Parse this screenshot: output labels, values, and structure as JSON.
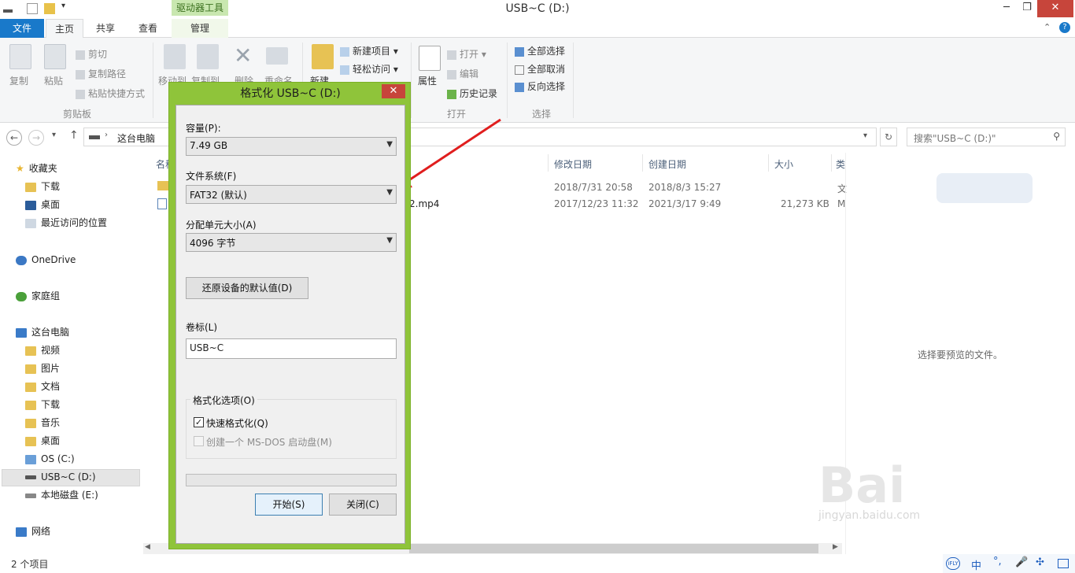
{
  "window": {
    "title": "USB~C (D:)",
    "context_tab_header": "驱动器工具",
    "minimize_glyph": "─",
    "maximize_glyph": "❐",
    "close_glyph": "✕"
  },
  "tabs": [
    {
      "label": "文件"
    },
    {
      "label": "主页"
    },
    {
      "label": "共享"
    },
    {
      "label": "查看"
    },
    {
      "label": "管理"
    }
  ],
  "ribbon": {
    "clipboard": {
      "copy": "复制",
      "paste": "粘贴",
      "cut": "剪切",
      "copy_path": "复制路径",
      "paste_shortcut": "粘贴快捷方式",
      "group": "剪贴板"
    },
    "organize": {
      "move_to": "移动到",
      "copy_to": "复制到",
      "delete": "删除",
      "rename": "重命名"
    },
    "new": {
      "new_folder": "新建",
      "new_item": "新建项目 ▾",
      "easy_access": "轻松访问 ▾"
    },
    "open": {
      "properties": "属性",
      "open": "打开 ▾",
      "edit": "编辑",
      "history": "历史记录",
      "group": "打开"
    },
    "select": {
      "select_all": "全部选择",
      "select_none": "全部取消",
      "invert": "反向选择",
      "group": "选择"
    }
  },
  "address": {
    "path_root": "这台电脑",
    "search_placeholder": "搜索\"USB~C (D:)\""
  },
  "nav": {
    "favorites": "收藏夹",
    "fav_items": [
      "下载",
      "桌面",
      "最近访问的位置"
    ],
    "onedrive": "OneDrive",
    "homegroup": "家庭组",
    "this_pc": "这台电脑",
    "pc_items": [
      "视频",
      "图片",
      "文档",
      "下载",
      "音乐",
      "桌面",
      "OS (C:)",
      "USB~C (D:)",
      "本地磁盘 (E:)"
    ],
    "network": "网络"
  },
  "files": {
    "headers": {
      "name": "名称",
      "modified": "修改日期",
      "created": "创建日期",
      "size": "大小",
      "type": "类"
    },
    "rows": [
      {
        "name": "",
        "modified": "2018/7/31 20:58",
        "created": "2018/8/3 15:27",
        "size": "",
        "type": "文"
      },
      {
        "name": "2.mp4",
        "modified": "2017/12/23 11:32",
        "created": "2021/3/17 9:49",
        "size": "21,273 KB",
        "type": "M"
      }
    ]
  },
  "preview": {
    "empty_text": "选择要预览的文件。"
  },
  "status": {
    "item_count": "2 个项目"
  },
  "dialog": {
    "title": "格式化 USB~C (D:)",
    "close_glyph": "✕",
    "capacity_label": "容量(P):",
    "capacity_value": "7.49 GB",
    "filesystem_label": "文件系统(F)",
    "filesystem_value": "FAT32 (默认)",
    "alloc_label": "分配单元大小(A)",
    "alloc_value": "4096 字节",
    "restore_button": "还原设备的默认值(D)",
    "volume_label": "卷标(L)",
    "volume_value": "USB~C",
    "options_label": "格式化选项(O)",
    "quick_format": "快速格式化(Q)",
    "quick_format_checked": true,
    "msdos_disk": "创建一个 MS-DOS 启动盘(M)",
    "start_button": "开始(S)",
    "close_button": "关闭(C)"
  },
  "watermark": {
    "text": "Bai",
    "sub": "jingyan.baidu.com"
  },
  "tray": {
    "ime": "中"
  }
}
